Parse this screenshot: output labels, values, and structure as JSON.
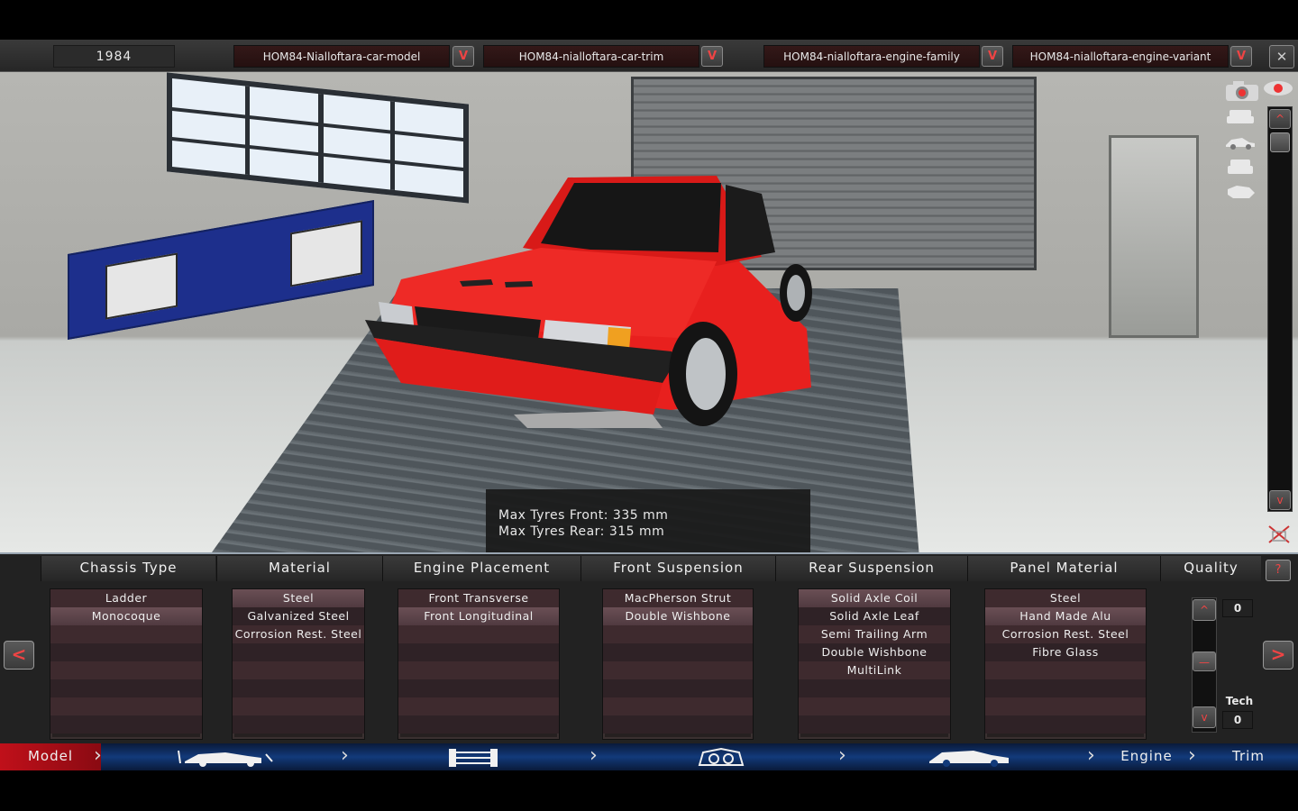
{
  "topbar": {
    "year": "1984",
    "car_model": "HOM84-Nialloftara-car-model",
    "car_trim": "HOM84-nialloftara-car-trim",
    "engine_family": "HOM84-nialloftara-engine-family",
    "engine_variant": "HOM84-nialloftara-engine-variant",
    "dropdown_glyph": "V",
    "close_glyph": "✕"
  },
  "viewport": {
    "info_line_1": "Max Tyres Front: 335 mm",
    "info_line_2": "Max Tyres Rear: 315 mm",
    "car_color": "#e8201e",
    "icons": [
      "camera-icon",
      "car-front-view-icon",
      "car-side-view-icon",
      "car-rear-view-icon",
      "car-top-view-icon",
      "eye-icon",
      "lock-icon"
    ]
  },
  "panel": {
    "columns": [
      {
        "name": "chassis-type",
        "header": "Chassis Type",
        "items": [
          "Ladder",
          "Monocoque"
        ],
        "selected": 1
      },
      {
        "name": "material",
        "header": "Material",
        "items": [
          "Steel",
          "Galvanized Steel",
          "Corrosion Rest. Steel"
        ],
        "selected": 0
      },
      {
        "name": "engine-placement",
        "header": "Engine Placement",
        "items": [
          "Front Transverse",
          "Front Longitudinal"
        ],
        "selected": 1
      },
      {
        "name": "front-suspension",
        "header": "Front Suspension",
        "items": [
          "MacPherson Strut",
          "Double Wishbone"
        ],
        "selected": 1
      },
      {
        "name": "rear-suspension",
        "header": "Rear Suspension",
        "items": [
          "Solid Axle Coil",
          "Solid Axle Leaf",
          "Semi Trailing Arm",
          "Double Wishbone",
          "MultiLink"
        ],
        "selected": 0
      },
      {
        "name": "panel-material",
        "header": "Panel Material",
        "items": [
          "Steel",
          "Hand Made Alu",
          "Corrosion Rest. Steel",
          "Fibre Glass"
        ],
        "selected": 1
      }
    ],
    "quality": {
      "header": "Quality",
      "value": "0",
      "tech_label": "Tech",
      "tech_value": "0"
    },
    "help_glyph": "?",
    "prev_glyph": "<",
    "next_glyph": ">"
  },
  "tabs": {
    "model": "Model",
    "engine": "Engine",
    "trim": "Trim",
    "active_color": "#c0101a"
  }
}
